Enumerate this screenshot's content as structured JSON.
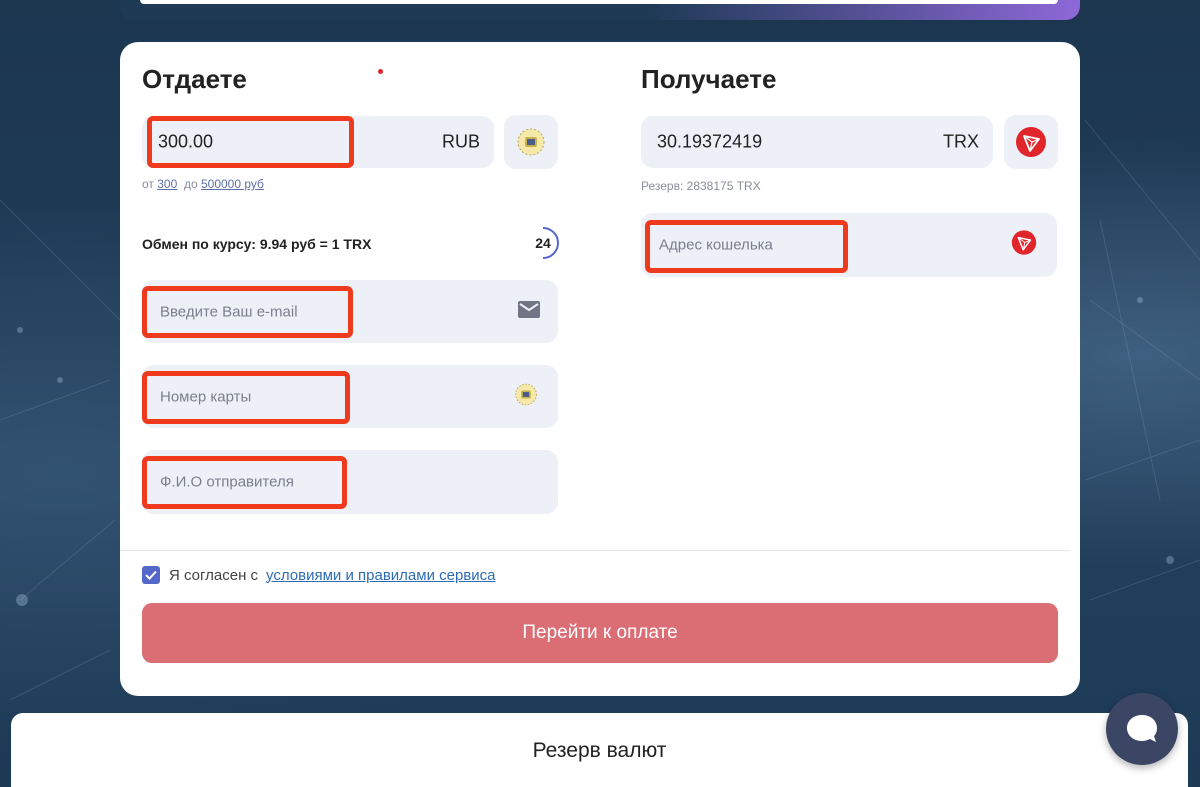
{
  "give": {
    "title": "Отдаете",
    "amount": "300.00",
    "currency": "RUB",
    "limit_from_label": "от",
    "limit_min": "300",
    "limit_to_label": "до",
    "limit_max": "500000 руб",
    "rate": "Обмен по курсу: 9.94 руб = 1 TRX",
    "timer": "24",
    "email_placeholder": "Введите Ваш e-mail",
    "card_placeholder": "Номер карты",
    "name_placeholder": "Ф.И.О отправителя"
  },
  "receive": {
    "title": "Получаете",
    "amount": "30.19372419",
    "currency": "TRX",
    "reserve": "Резерв: 2838175 TRX",
    "wallet_placeholder": "Адрес кошелька"
  },
  "agree": {
    "text": "Я согласен с",
    "link": "условиями и правилами сервиса",
    "checked": true
  },
  "pay_button": "Перейти к оплате",
  "reserve_section_title": "Резерв валют",
  "icons": {
    "rub_bank": "bank-logo-icon",
    "trx": "tron-icon",
    "email": "mail-icon",
    "chat": "chat-icon"
  },
  "colors": {
    "highlight": "#f03a1e",
    "pay_button": "#db6d75",
    "tron": "#e0262a",
    "checkbox": "#5468c9"
  }
}
